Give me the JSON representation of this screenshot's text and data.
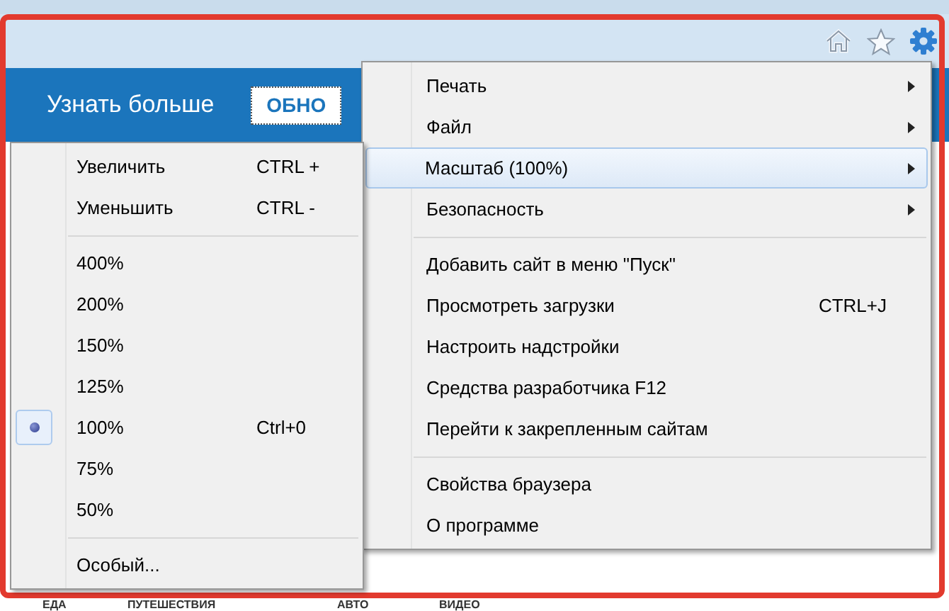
{
  "banner": {
    "link": "Узнать больше",
    "button": "ОБНО"
  },
  "tools_menu": {
    "groups": [
      {
        "items": [
          {
            "label": "Печать",
            "submenu": true,
            "selected": false
          },
          {
            "label": "Файл",
            "submenu": true,
            "selected": false
          },
          {
            "label": "Масштаб (100%)",
            "submenu": true,
            "selected": true
          },
          {
            "label": "Безопасность",
            "submenu": true,
            "selected": false
          }
        ]
      },
      {
        "items": [
          {
            "label": "Добавить сайт в меню \"Пуск\"",
            "submenu": false,
            "selected": false
          },
          {
            "label": "Просмотреть загрузки",
            "shortcut": "CTRL+J",
            "submenu": false,
            "selected": false
          },
          {
            "label": "Настроить надстройки",
            "submenu": false,
            "selected": false
          },
          {
            "label": "Средства разработчика F12",
            "submenu": false,
            "selected": false
          },
          {
            "label": "Перейти к закрепленным сайтам",
            "submenu": false,
            "selected": false
          }
        ]
      },
      {
        "items": [
          {
            "label": "Свойства браузера",
            "submenu": false,
            "selected": false
          },
          {
            "label": "О программе",
            "submenu": false,
            "selected": false
          }
        ]
      }
    ]
  },
  "zoom_menu": {
    "groups": [
      {
        "items": [
          {
            "label": "Увеличить",
            "shortcut": "CTRL +",
            "selected": false
          },
          {
            "label": "Уменьшить",
            "shortcut": "CTRL -",
            "selected": false
          }
        ]
      },
      {
        "items": [
          {
            "label": "400%",
            "selected": false
          },
          {
            "label": "200%",
            "selected": false
          },
          {
            "label": "150%",
            "selected": false
          },
          {
            "label": "125%",
            "selected": false
          },
          {
            "label": "100%",
            "shortcut": "Ctrl+0",
            "selected": true
          },
          {
            "label": "75%",
            "selected": false
          },
          {
            "label": "50%",
            "selected": false
          }
        ]
      },
      {
        "items": [
          {
            "label": "Особый...",
            "selected": false
          }
        ]
      }
    ]
  },
  "nav": [
    "ЕДА",
    "ПУТЕШЕСТВИЯ",
    "АВТО",
    "ВИДЕО"
  ]
}
